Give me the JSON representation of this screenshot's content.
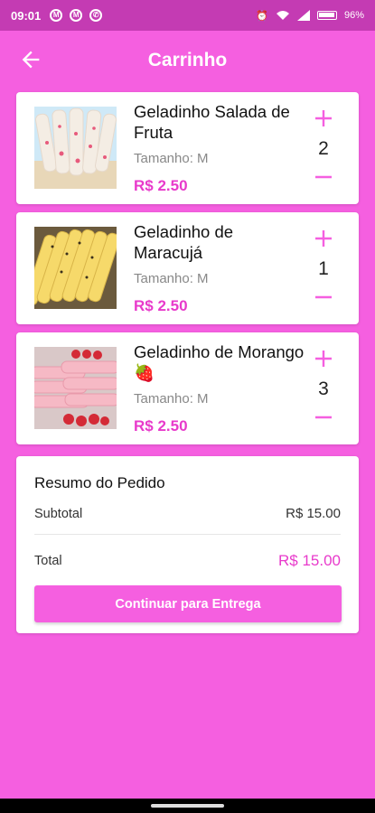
{
  "status_bar": {
    "time": "09:01",
    "battery": "96%",
    "notification_icons": [
      "gmail-icon",
      "gmail-icon",
      "whatsapp-icon"
    ],
    "system_icons": [
      "alarm-icon",
      "wifi-icon",
      "signal-icon",
      "battery-icon"
    ]
  },
  "app_bar": {
    "title": "Carrinho",
    "back_icon": "arrow-left-icon"
  },
  "cart": {
    "items": [
      {
        "name": "Geladinho Salada de Fruta",
        "size": "Tamanho: M",
        "price": "R$ 2.50",
        "quantity": "2"
      },
      {
        "name": "Geladinho de Maracujá",
        "size": "Tamanho: M",
        "price": "R$ 2.50",
        "quantity": "1"
      },
      {
        "name": "Geladinho de Morango 🍓",
        "size": "Tamanho: M",
        "price": "R$ 2.50",
        "quantity": "3"
      }
    ]
  },
  "summary": {
    "heading": "Resumo do Pedido",
    "subtotal_label": "Subtotal",
    "subtotal_value": "R$ 15.00",
    "total_label": "Total",
    "total_value": "R$ 15.00",
    "continue_button": "Continuar para Entrega"
  },
  "colors": {
    "background": "#f55fe0",
    "status_bar": "#c43bb3",
    "accent": "#e83acb",
    "card": "#ffffff"
  }
}
